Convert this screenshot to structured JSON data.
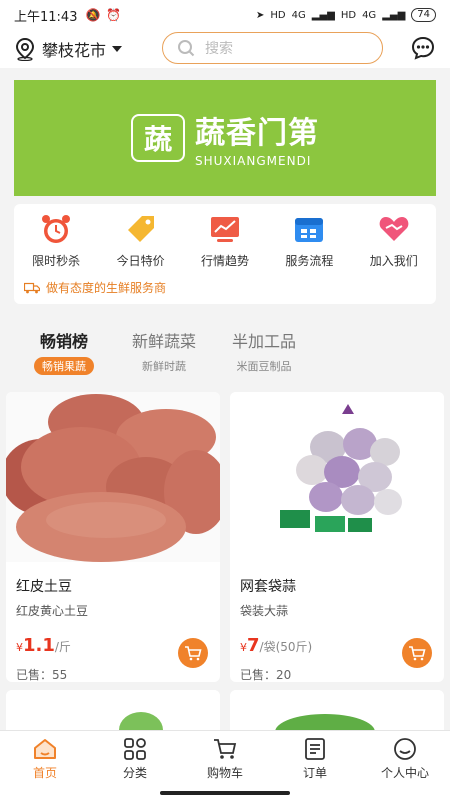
{
  "status": {
    "time": "上午11:43",
    "hd1": "HD",
    "net1": "4G",
    "hd2": "HD",
    "net2": "4G",
    "battery": "74"
  },
  "header": {
    "city": "攀枝花市",
    "search_placeholder": "搜索"
  },
  "banner": {
    "logo_char": "蔬",
    "brand_cn": "蔬香门第",
    "brand_en": "SHUXIANGMENDI"
  },
  "services": {
    "items": [
      {
        "label": "限时秒杀",
        "icon": "alarm-clock-icon",
        "color": "#f0553a"
      },
      {
        "label": "今日特价",
        "icon": "price-tag-icon",
        "color": "#f5b731"
      },
      {
        "label": "行情趋势",
        "icon": "trend-chart-icon",
        "color": "#ef5b45"
      },
      {
        "label": "服务流程",
        "icon": "calendar-icon",
        "color": "#2f8cf0"
      },
      {
        "label": "加入我们",
        "icon": "handshake-icon",
        "color": "#f0557a"
      }
    ],
    "slogan": "做有态度的生鲜服务商"
  },
  "tabs": [
    {
      "title": "畅销榜",
      "sub": "畅销果蔬",
      "active": true
    },
    {
      "title": "新鲜蔬菜",
      "sub": "新鲜时蔬",
      "active": false
    },
    {
      "title": "半加工品",
      "sub": "米面豆制品",
      "active": false
    }
  ],
  "products": [
    {
      "name": "红皮土豆",
      "sub": "红皮黄心土豆",
      "currency": "¥",
      "price": "1.1",
      "unit": "/斤",
      "sold": "已售：55"
    },
    {
      "name": "网套袋蒜",
      "sub": "袋装大蒜",
      "currency": "¥",
      "price": "7",
      "unit": "/袋(50斤)",
      "sold": "已售：20"
    }
  ],
  "tabbar": [
    {
      "label": "首页",
      "icon": "home-icon",
      "active": true
    },
    {
      "label": "分类",
      "icon": "category-grid-icon",
      "active": false
    },
    {
      "label": "购物车",
      "icon": "shopping-cart-icon",
      "active": false
    },
    {
      "label": "订单",
      "icon": "order-list-icon",
      "active": false
    },
    {
      "label": "个人中心",
      "icon": "profile-icon",
      "active": false
    }
  ],
  "colors": {
    "accent": "#f0822a",
    "banner": "#8cc63f",
    "price": "#e8351f"
  }
}
